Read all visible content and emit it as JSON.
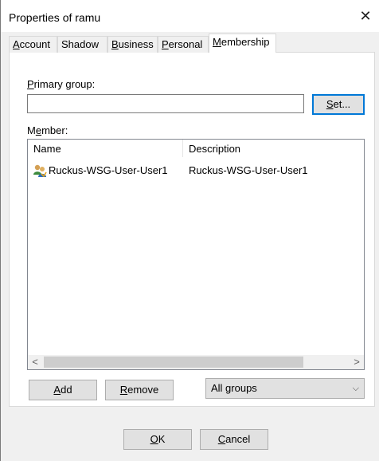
{
  "window": {
    "title": "Properties of ramu",
    "close_glyph": "✕"
  },
  "tabs": [
    {
      "label": "Account",
      "underline": "A",
      "rest": "ccount",
      "active": false
    },
    {
      "label": "Shadow",
      "underline": "",
      "rest": "Shadow",
      "active": false
    },
    {
      "label": "Business",
      "underline": "B",
      "rest": "usiness",
      "active": false
    },
    {
      "label": "Personal",
      "underline": "P",
      "rest": "ersonal",
      "active": false
    },
    {
      "label": "Membership",
      "underline": "M",
      "rest": "embership",
      "active": true
    }
  ],
  "membership": {
    "primary_group": {
      "label_u": "P",
      "label_rest": "rimary group:",
      "value": ""
    },
    "set_button": {
      "u": "S",
      "rest": "et..."
    },
    "member_label": {
      "pre": "M",
      "u": "e",
      "rest": "mber:"
    },
    "list": {
      "columns": [
        "Name",
        "Description"
      ],
      "rows": [
        {
          "icon": "user-group-icon",
          "name": "Ruckus-WSG-User-User1",
          "description": "Ruckus-WSG-User-User1"
        }
      ],
      "scroll_left": "<",
      "scroll_right": ">"
    },
    "add_button": {
      "u": "A",
      "rest": "dd"
    },
    "remove_button": {
      "u": "R",
      "rest": "emove"
    },
    "filter_select": {
      "value": "All groups",
      "chevron": "⌵"
    }
  },
  "footer": {
    "ok_button": {
      "u": "O",
      "rest": "K"
    },
    "cancel_button": {
      "u": "C",
      "rest": "ancel"
    }
  },
  "colors": {
    "accent": "#0078d7",
    "window_bg": "#f0f0f0",
    "panel_bg": "#ffffff"
  }
}
